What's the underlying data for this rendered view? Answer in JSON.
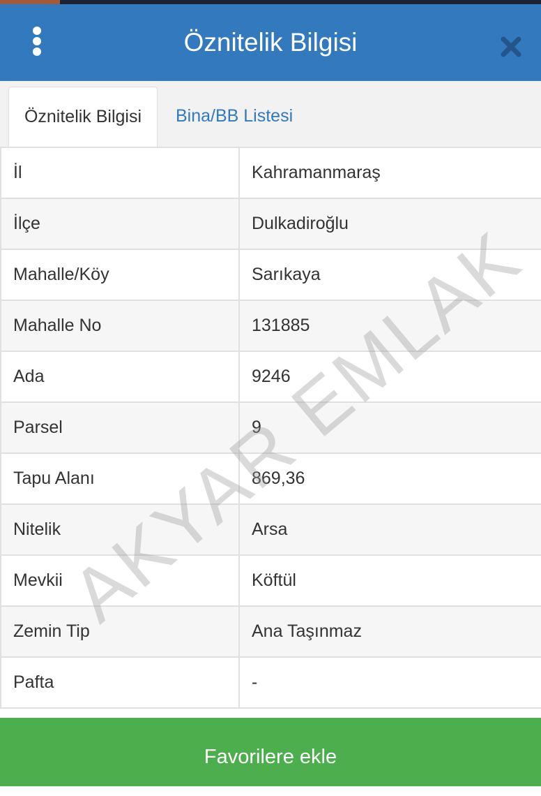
{
  "header": {
    "title": "Öznitelik Bilgisi",
    "menu_icon": "kebab-menu-icon",
    "close_icon": "close-icon",
    "color": "#3279bd"
  },
  "tabs": [
    {
      "label": "Öznitelik Bilgisi",
      "active": true
    },
    {
      "label": "Bina/BB Listesi",
      "active": false
    }
  ],
  "attributes": [
    {
      "label": "İl",
      "value": "Kahramanmaraş"
    },
    {
      "label": "İlçe",
      "value": "Dulkadiroğlu"
    },
    {
      "label": "Mahalle/Köy",
      "value": "Sarıkaya"
    },
    {
      "label": "Mahalle No",
      "value": "131885"
    },
    {
      "label": "Ada",
      "value": "9246"
    },
    {
      "label": "Parsel",
      "value": "9"
    },
    {
      "label": "Tapu Alanı",
      "value": "869,36"
    },
    {
      "label": "Nitelik",
      "value": "Arsa"
    },
    {
      "label": "Mevkii",
      "value": "Köftül"
    },
    {
      "label": "Zemin Tip",
      "value": "Ana Taşınmaz"
    },
    {
      "label": "Pafta",
      "value": "-"
    }
  ],
  "footer": {
    "button_label": "Favorilere ekle",
    "color": "#4cae4c"
  },
  "watermark": {
    "text": "AKYAR EMLAK"
  }
}
